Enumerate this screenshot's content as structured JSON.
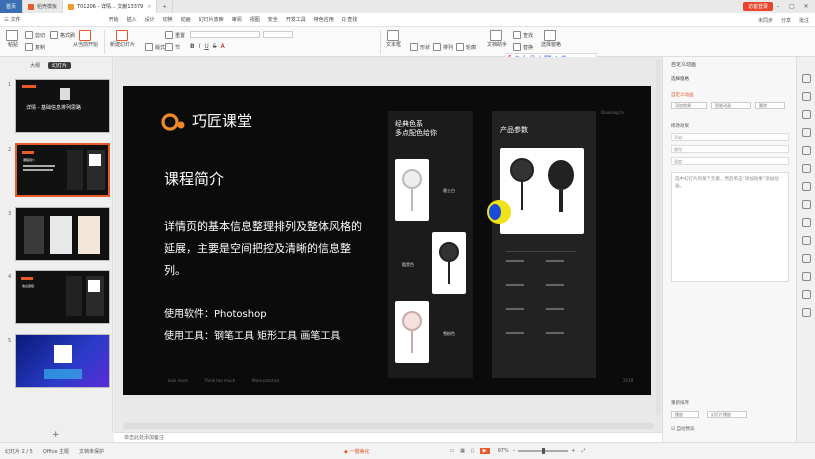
{
  "titlebar": {
    "home": "首页",
    "tabs": [
      {
        "label": "稻壳模板",
        "color": "#e85a2a"
      },
      {
        "label": "T01206 - 详情... 文献13379",
        "color": "#f09a2d"
      }
    ],
    "login": "访客登录"
  },
  "menubar": {
    "file": "三 文件",
    "items": [
      "开始",
      "插入",
      "设计",
      "切换",
      "动画",
      "幻灯片放映",
      "审阅",
      "视图",
      "安全",
      "开发工具",
      "特色应用"
    ],
    "active": "开始",
    "search": "Q 查找",
    "right": [
      "未同步",
      "分享",
      "批注"
    ]
  },
  "ribbon": {
    "groups": [
      "粘贴",
      "剪切",
      "复制",
      "格式刷",
      "从当前开始",
      "新建幻灯片",
      "版式",
      "重置",
      "节",
      "文本框",
      "形状",
      "排列",
      "轮廓",
      "文档助手",
      "查找",
      "替换",
      "选择窗格"
    ]
  },
  "leftpanel": {
    "tabs": [
      "大纲",
      "幻灯片"
    ],
    "selected_tab": "幻灯片",
    "slides": [
      {
        "num": "1",
        "title": "详情 - 基础信息排列思路"
      },
      {
        "num": "2",
        "title": "课程简介"
      },
      {
        "num": "3",
        "title": ""
      },
      {
        "num": "4",
        "title": "信息层级"
      },
      {
        "num": "5",
        "title": ""
      }
    ],
    "selected_slide": 2
  },
  "slide": {
    "brand": "巧匠课堂",
    "heading": "课程简介",
    "paragraph": "详情页的基本信息整理排列及整体风格的延展，主要是空间把控及清晰的信息整列。",
    "software": "使用软件：Photoshop",
    "tools": "使用工具：钢笔工具 矩形工具 画笔工具",
    "footer": [
      "look more",
      "Think too much",
      "More practice"
    ],
    "year": "2019",
    "panelA": {
      "title1": "经典色系",
      "title2": "多点配色给你",
      "labels": [
        "雅士白",
        "酷黑色",
        "雪粉色"
      ]
    },
    "panelB": {
      "title": "产品参数",
      "brand_mark": "Diaolong.tv"
    }
  },
  "notes": {
    "placeholder": "单击此处添加备注"
  },
  "rightpane": {
    "title": "自定义动画",
    "select_pane": "选择窗格",
    "custom_anim": "自定义动画",
    "add_effect": "添加效果",
    "smart_anim": "智能动画",
    "delete": "删除",
    "modify_label": "修改效果",
    "start": "开始:",
    "property": "属性:",
    "speed": "速度:",
    "hint": "选中幻灯片的某个元素，然后单击“添加效果”添加动画。",
    "reorder": "重新排序",
    "play": "播放",
    "slideshow": "幻灯片播放",
    "autopreview": "自动预览"
  },
  "statusbar": {
    "slide": "幻灯片 2 / 5",
    "theme": "Office 主题",
    "protect": "文档未保护",
    "beautify": "一键美化",
    "zoom": "97%"
  }
}
